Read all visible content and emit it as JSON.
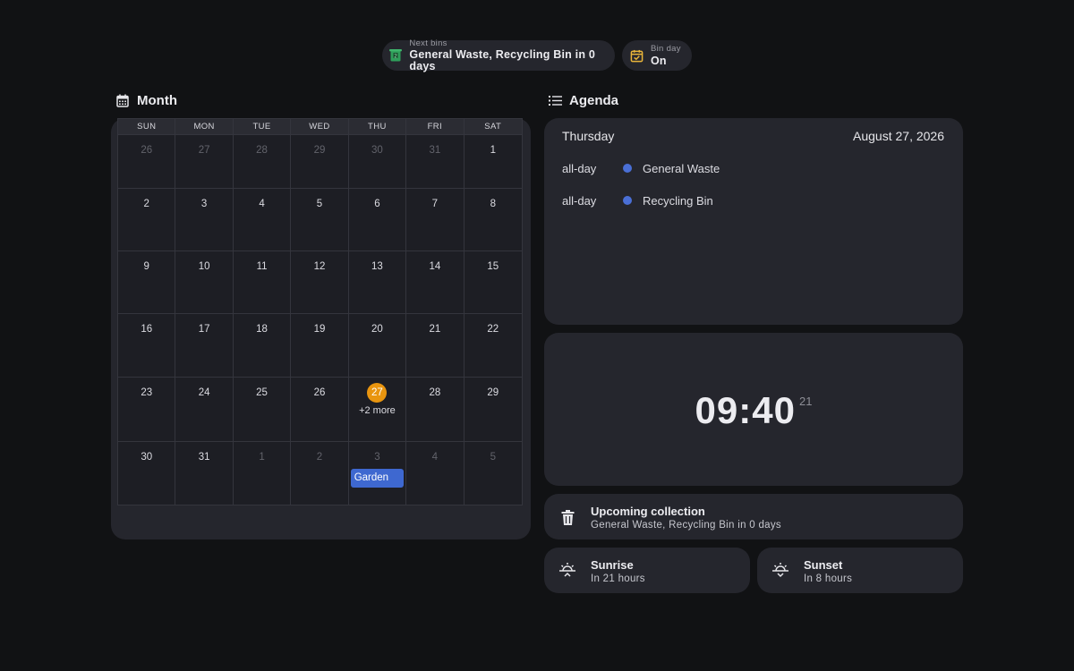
{
  "chips": {
    "next_bins": {
      "label": "Next bins",
      "value": "General Waste, Recycling Bin in 0 days",
      "icon": "wheelie-bin-icon",
      "color": "#2f9e5a"
    },
    "bin_day": {
      "label": "Bin day",
      "value": "On",
      "icon": "calendar-check-icon",
      "color": "#e9b53a"
    }
  },
  "month": {
    "title": "Month",
    "icon": "calendar-icon",
    "weekdays": [
      "SUN",
      "MON",
      "TUE",
      "WED",
      "THU",
      "FRI",
      "SAT"
    ],
    "weeks": [
      [
        "26",
        "27",
        "28",
        "29",
        "30",
        "31",
        "1"
      ],
      [
        "2",
        "3",
        "4",
        "5",
        "6",
        "7",
        "8"
      ],
      [
        "9",
        "10",
        "11",
        "12",
        "13",
        "14",
        "15"
      ],
      [
        "16",
        "17",
        "18",
        "19",
        "20",
        "21",
        "22"
      ],
      [
        "23",
        "24",
        "25",
        "26",
        "27",
        "28",
        "29"
      ],
      [
        "30",
        "31",
        "1",
        "2",
        "3",
        "4",
        "5"
      ]
    ],
    "today": "27",
    "more_label": "+2 more",
    "event_label": "Garden",
    "today_color": "#e9950f",
    "event_color": "#3e68d0"
  },
  "agenda": {
    "title": "Agenda",
    "icon": "list-icon",
    "day": "Thursday",
    "date": "August 27, 2026",
    "items": [
      {
        "time": "all-day",
        "name": "General Waste"
      },
      {
        "time": "all-day",
        "name": "Recycling Bin"
      }
    ],
    "dot_color": "#4a6fd6"
  },
  "clock": {
    "time": "09:40",
    "seconds": "21"
  },
  "upcoming": {
    "title": "Upcoming collection",
    "subtitle": "General Waste, Recycling Bin in 0 days",
    "icon": "trash-icon"
  },
  "sunrise": {
    "title": "Sunrise",
    "subtitle": "In 21 hours",
    "icon": "sunrise-icon"
  },
  "sunset": {
    "title": "Sunset",
    "subtitle": "In 8 hours",
    "icon": "sunset-icon"
  }
}
